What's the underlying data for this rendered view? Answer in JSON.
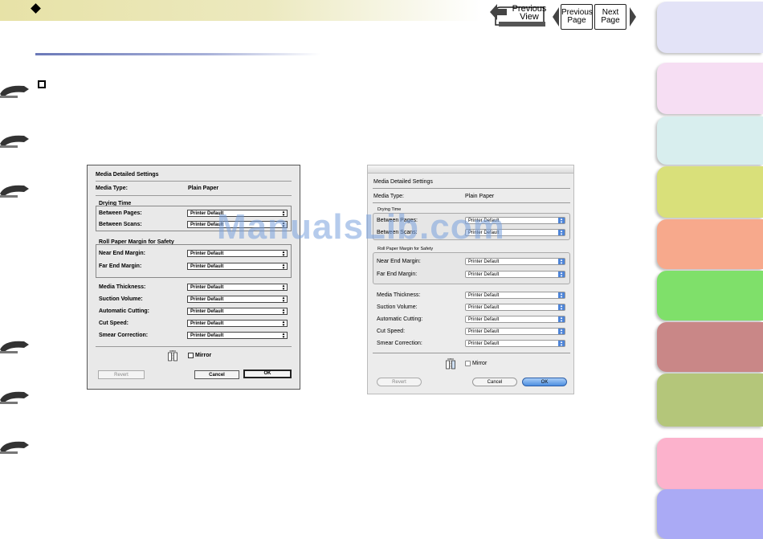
{
  "nav": {
    "previous_view_label": "Previous\nView",
    "previous_page_label": "Previous\nPage",
    "next_page_label": "Next\nPage"
  },
  "dialog_classic": {
    "title": "Media Detailed Settings",
    "media_type_label": "Media Type:",
    "media_type_value": "Plain Paper",
    "drying_time_group": "Drying Time",
    "between_pages_label": "Between Pages:",
    "between_pages_value": "Printer Default",
    "between_scans_label": "Between Scans:",
    "between_scans_value": "Printer Default",
    "roll_margin_group": "Roll Paper Margin for Safety",
    "near_end_label": "Near End Margin:",
    "near_end_value": "Printer Default",
    "far_end_label": "Far End Margin:",
    "far_end_value": "Printer Default",
    "media_thickness_label": "Media Thickness:",
    "media_thickness_value": "Printer Default",
    "suction_volume_label": "Suction Volume:",
    "suction_volume_value": "Printer Default",
    "automatic_cutting_label": "Automatic Cutting:",
    "automatic_cutting_value": "Printer Default",
    "cut_speed_label": "Cut Speed:",
    "cut_speed_value": "Printer Default",
    "smear_correction_label": "Smear Correction:",
    "smear_correction_value": "Printer Default",
    "mirror_label": "Mirror",
    "revert_label": "Revert",
    "cancel_label": "Cancel",
    "ok_label": "OK"
  },
  "dialog_aqua": {
    "title": "Media Detailed Settings",
    "media_type_label": "Media Type:",
    "media_type_value": "Plain Paper",
    "drying_time_group": "Drying Time",
    "between_pages_label": "Between Pages:",
    "between_pages_value": "Printer Default",
    "between_scans_label": "Between Scans:",
    "between_scans_value": "Printer Default",
    "roll_margin_group": "Roll Paper Margin for Safety",
    "near_end_label": "Near End Margin:",
    "near_end_value": "Printer Default",
    "far_end_label": "Far End Margin:",
    "far_end_value": "Printer Default",
    "media_thickness_label": "Media Thickness:",
    "media_thickness_value": "Printer Default",
    "suction_volume_label": "Suction Volume:",
    "suction_volume_value": "Printer Default",
    "automatic_cutting_label": "Automatic Cutting:",
    "automatic_cutting_value": "Printer Default",
    "cut_speed_label": "Cut Speed:",
    "cut_speed_value": "Printer Default",
    "smear_correction_label": "Smear Correction:",
    "smear_correction_value": "Printer Default",
    "mirror_label": "Mirror",
    "revert_label": "Revert",
    "cancel_label": "Cancel",
    "ok_label": "OK"
  },
  "watermark": "ManualsLib.com",
  "colors": {
    "header_band": "#e7e2a7",
    "rule": "#6b79b8",
    "aqua_accent": "#4d84d8",
    "tabs": [
      "#e3e3f7",
      "#f6def3",
      "#d8eeee",
      "#d9e07a",
      "#f7a98c",
      "#7fe06a",
      "#c98787",
      "#b4c67a",
      "#fcb2cc",
      "#aaaaf5"
    ]
  },
  "icons": [
    "diamond-icon",
    "checkbox-square-icon",
    "return-arrow-icon",
    "page-hook-icon",
    "mirror-icon"
  ]
}
